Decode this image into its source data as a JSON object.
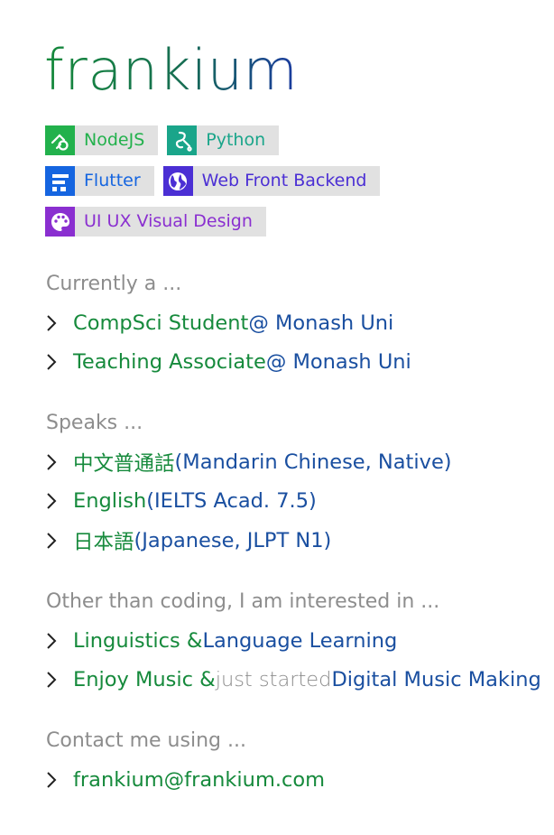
{
  "title": "frankium",
  "badges": [
    {
      "label": "NodeJS",
      "icon": "nodejs-icon",
      "color": "#22b14c"
    },
    {
      "label": "Python",
      "icon": "python-icon",
      "color": "#1aa58a"
    },
    {
      "label": "Flutter",
      "icon": "flutter-icon",
      "color": "#1565e0"
    },
    {
      "label": "Web Front Backend",
      "icon": "globe-icon",
      "color": "#4b2fd4"
    },
    {
      "label": "UI UX Visual Design",
      "icon": "palette-icon",
      "color": "#8a2fd0"
    }
  ],
  "sections": {
    "current": {
      "heading": "Currently a ...",
      "items": [
        {
          "a": "CompSci Student",
          "b": " @ Monash Uni"
        },
        {
          "a": "Teaching Associate",
          "b": " @ Monash Uni"
        }
      ]
    },
    "speaks": {
      "heading": "Speaks ...",
      "items": [
        {
          "a": "中文普通話",
          "b": " (Mandarin Chinese, Native)"
        },
        {
          "a": "English",
          "b": " (IELTS Acad. 7.5)"
        },
        {
          "a": "日本語",
          "b": " (Japanese, JLPT N1)"
        }
      ]
    },
    "interests": {
      "heading": "Other than coding, I am interested in ...",
      "items": [
        {
          "a": "Linguistics & ",
          "b": "Language Learning"
        },
        {
          "a": "Enjoy Music & ",
          "muted": "just started ",
          "b": "Digital Music Making"
        }
      ]
    },
    "contact": {
      "heading": "Contact me using ...",
      "items": [
        {
          "a": "frankium@frankium.com"
        }
      ]
    }
  }
}
